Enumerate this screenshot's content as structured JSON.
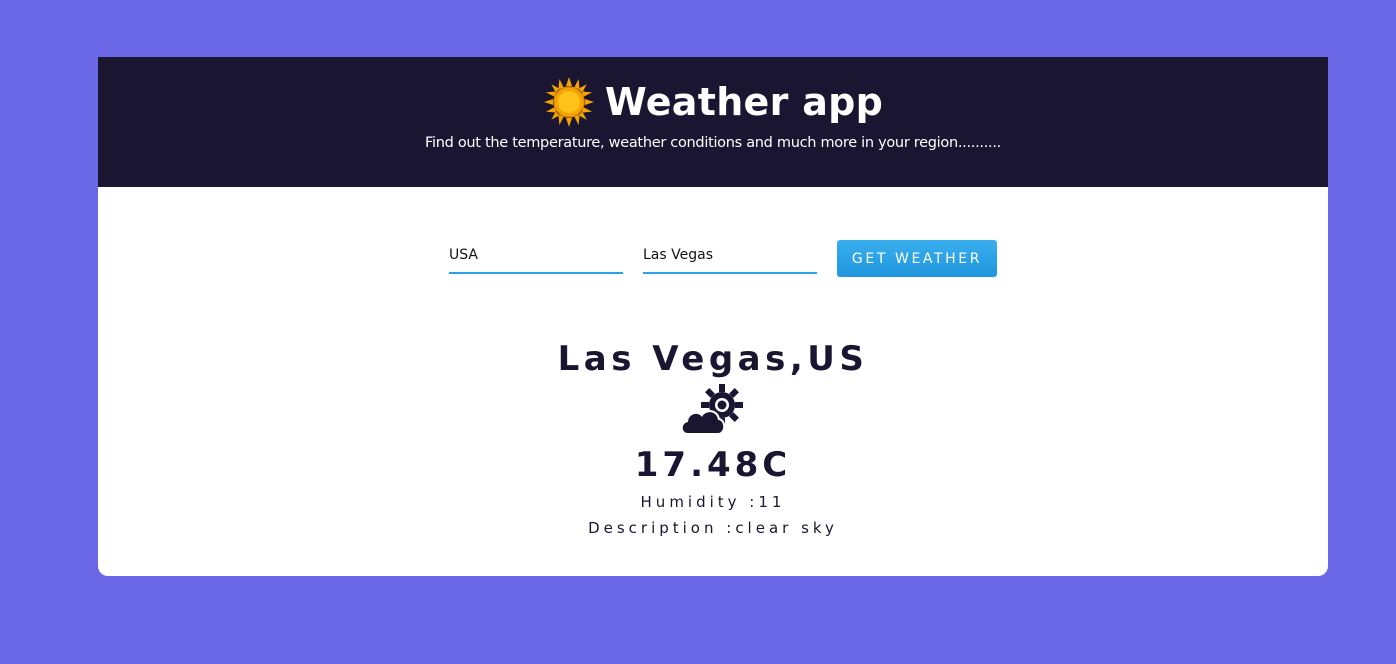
{
  "header": {
    "title": "Weather app",
    "subtitle": "Find out the temperature, weather conditions and much more in your region..........",
    "icon": "sun-icon"
  },
  "form": {
    "country_value": "USA",
    "city_value": "Las Vegas",
    "button_label": "GET WEATHER"
  },
  "result": {
    "location": "Las Vegas,US",
    "icon": "cloud-sun-icon",
    "temperature": "17.48C",
    "humidity": "Humidity :11",
    "description": "Description :clear sky"
  },
  "colors": {
    "background": "#6b68e8",
    "header": "#1a1530",
    "accent": "#2aa3e9",
    "sun": "#f5a300"
  }
}
